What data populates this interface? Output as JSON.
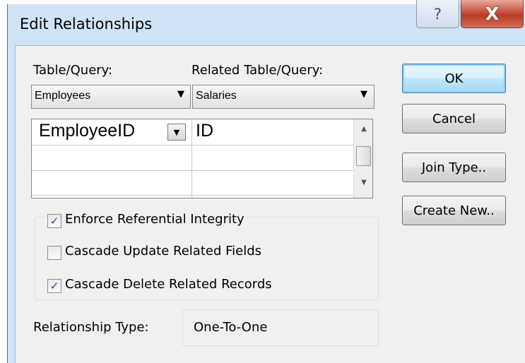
{
  "window": {
    "title": "Edit Relationships",
    "help_glyph": "?",
    "close_glyph": "X"
  },
  "labels": {
    "table_query": "Table/Query:",
    "related_table_query": "Related Table/Query:"
  },
  "combos": {
    "table": "Employees",
    "related": "Salaries"
  },
  "fields": [
    {
      "left": "EmployeeID",
      "right": "ID"
    },
    {
      "left": "",
      "right": ""
    },
    {
      "left": "",
      "right": ""
    }
  ],
  "options": {
    "enforce": {
      "label": "Enforce Referential Integrity",
      "checked": true
    },
    "cascade_update": {
      "label": "Cascade Update Related Fields",
      "checked": false
    },
    "cascade_delete": {
      "label": "Cascade Delete Related Records",
      "checked": true
    }
  },
  "relationship": {
    "label": "Relationship Type:",
    "value": "One-To-One"
  },
  "buttons": {
    "ok": "OK",
    "cancel": "Cancel",
    "join_type": "Join Type..",
    "create_new": "Create New.."
  },
  "icons": {
    "dropdown": "dropdown-arrow-icon",
    "check": "checkmark-icon",
    "scroll_up": "scroll-up-icon",
    "scroll_down": "scroll-down-icon"
  },
  "colors": {
    "client_bg": "#f0f0f0",
    "title_bar": "#d1e4f6",
    "close_button": "#c7503b",
    "default_button_border": "#3c7fb1"
  }
}
